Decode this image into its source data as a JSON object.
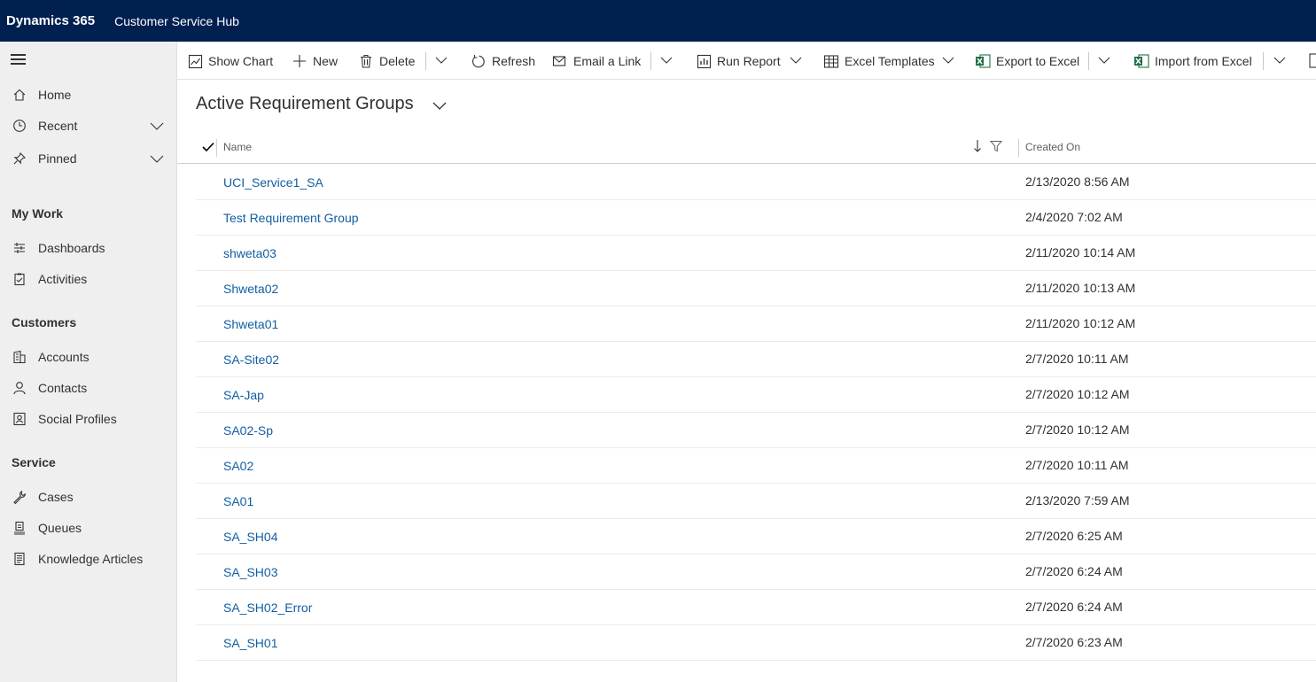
{
  "topbar": {
    "brand": "Dynamics 365",
    "app_name": "Customer Service Hub"
  },
  "sidebar": {
    "menu_icon": "hamburger-icon",
    "items_top": [
      {
        "label": "Home",
        "icon": "home-icon"
      },
      {
        "label": "Recent",
        "icon": "clock-icon"
      },
      {
        "label": "Pinned",
        "icon": "pin-icon"
      }
    ],
    "groups": [
      {
        "title": "My Work",
        "items": [
          {
            "label": "Dashboards",
            "icon": "dashboard-icon"
          },
          {
            "label": "Activities",
            "icon": "clipboard-icon"
          }
        ]
      },
      {
        "title": "Customers",
        "items": [
          {
            "label": "Accounts",
            "icon": "building-icon"
          },
          {
            "label": "Contacts",
            "icon": "person-icon"
          },
          {
            "label": "Social Profiles",
            "icon": "social-profile-icon"
          }
        ]
      },
      {
        "title": "Service",
        "items": [
          {
            "label": "Cases",
            "icon": "wrench-icon"
          },
          {
            "label": "Queues",
            "icon": "queue-icon"
          },
          {
            "label": "Knowledge Articles",
            "icon": "book-icon"
          }
        ]
      }
    ]
  },
  "commands": {
    "show_chart": "Show Chart",
    "new": "New",
    "delete": "Delete",
    "refresh": "Refresh",
    "email_link": "Email a Link",
    "run_report": "Run Report",
    "excel_templates": "Excel Templates",
    "export_excel": "Export to Excel",
    "import_excel": "Import from Excel"
  },
  "view": {
    "title": "Active Requirement Groups"
  },
  "grid": {
    "columns": {
      "name": "Name",
      "created_on": "Created On"
    },
    "rows": [
      {
        "name": "UCI_Service1_SA",
        "created_on": "2/13/2020 8:56 AM"
      },
      {
        "name": "Test Requirement Group",
        "created_on": "2/4/2020 7:02 AM"
      },
      {
        "name": "shweta03",
        "created_on": "2/11/2020 10:14 AM"
      },
      {
        "name": "Shweta02",
        "created_on": "2/11/2020 10:13 AM"
      },
      {
        "name": "Shweta01",
        "created_on": "2/11/2020 10:12 AM"
      },
      {
        "name": "SA-Site02",
        "created_on": "2/7/2020 10:11 AM"
      },
      {
        "name": "SA-Jap",
        "created_on": "2/7/2020 10:12 AM"
      },
      {
        "name": "SA02-Sp",
        "created_on": "2/7/2020 10:12 AM"
      },
      {
        "name": "SA02",
        "created_on": "2/7/2020 10:11 AM"
      },
      {
        "name": "SA01",
        "created_on": "2/13/2020 7:59 AM"
      },
      {
        "name": "SA_SH04",
        "created_on": "2/7/2020 6:25 AM"
      },
      {
        "name": "SA_SH03",
        "created_on": "2/7/2020 6:24 AM"
      },
      {
        "name": "SA_SH02_Error",
        "created_on": "2/7/2020 6:24 AM"
      },
      {
        "name": "SA_SH01",
        "created_on": "2/7/2020 6:23 AM"
      }
    ]
  },
  "colors": {
    "topbar": "#002050",
    "link": "#115ea3",
    "sidebar_bg": "#efefef",
    "excel_green": "#1e7145"
  }
}
